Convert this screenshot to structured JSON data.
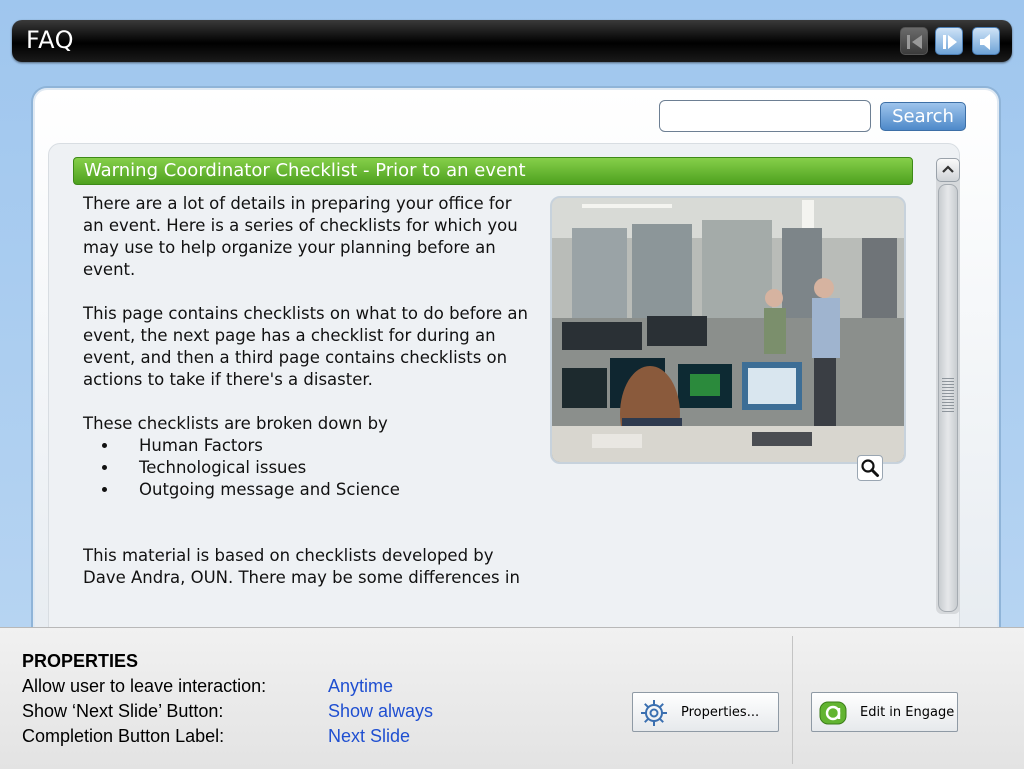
{
  "window": {
    "title": "FAQ",
    "nav": {
      "prev_icon": "prev-slide-icon",
      "next_icon": "next-slide-icon",
      "audio_icon": "audio-icon"
    }
  },
  "search": {
    "placeholder": "",
    "value": "",
    "button_label": "Search"
  },
  "content": {
    "heading": "Warning Coordinator Checklist - Prior to an event",
    "paragraphs": [
      "There are a lot of details in preparing your office for an event.  Here is a series of checklists for which you may use to help organize your planning before an event.",
      "This page contains checklists on what to do before an event, the next page has a checklist for during an event, and then a third page contains checklists on actions to take if there's a disaster."
    ],
    "list_intro": "These checklists are broken down by",
    "list_items": [
      "Human Factors",
      "Technological issues",
      "Outgoing message and Science"
    ],
    "footer_text": "This material is based on checklists developed by Dave Andra, OUN.  There may be some differences in your office.  Compare these",
    "photo_icon": "zoom-icon"
  },
  "properties": {
    "heading": "PROPERTIES",
    "rows": [
      {
        "label": "Allow user to leave interaction:",
        "value": "Anytime"
      },
      {
        "label": "Show ‘Next Slide’ Button:",
        "value": "Show always"
      },
      {
        "label": "Completion Button Label:",
        "value": "Next Slide"
      }
    ],
    "properties_button": "Properties...",
    "engage_button": "Edit in Engage"
  },
  "colors": {
    "accent_green": "#5cb22a",
    "value_blue": "#1f4fd1",
    "title_bar": "#000000"
  }
}
